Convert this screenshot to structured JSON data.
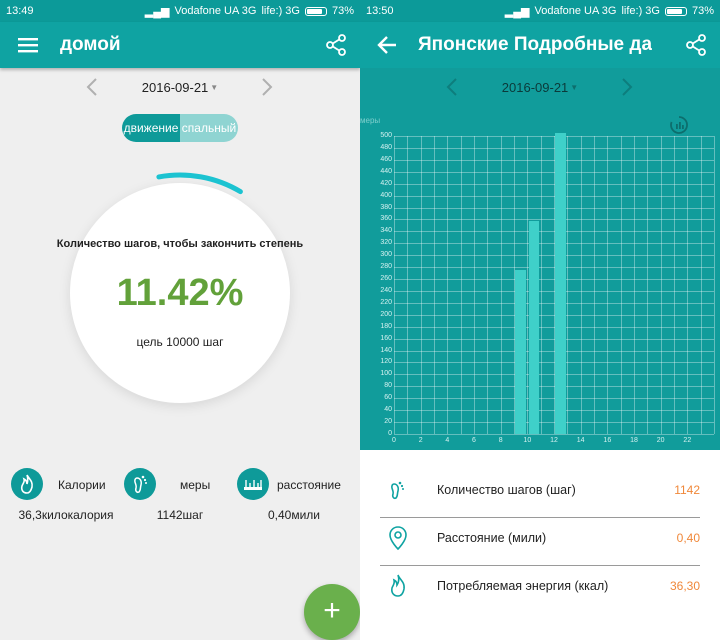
{
  "left": {
    "status": {
      "time": "13:49",
      "carrier": "Vodafone UA 3G",
      "carrier2": "life:) 3G",
      "battery": "73%"
    },
    "appbar": {
      "title": "домой"
    },
    "date": "2016-09-21",
    "toggle": {
      "active": "движение",
      "inactive": "спальный"
    },
    "progress": {
      "label": "Количество шагов, чтобы закончить степень",
      "percent_text": "11.42%",
      "fraction": 0.1142,
      "goal": "цель 10000 шаг"
    },
    "stats": [
      {
        "icon": "flame-icon",
        "label": "Калории",
        "value": "36,3килокалория"
      },
      {
        "icon": "footprint-icon",
        "label": "меры",
        "value": "1142шаг"
      },
      {
        "icon": "ruler-icon",
        "label": "расстояние",
        "value": "0,40мили"
      }
    ],
    "fab": {
      "label": "+"
    }
  },
  "right": {
    "status": {
      "time": "13:50",
      "carrier": "Vodafone UA 3G",
      "carrier2": "life:) 3G",
      "battery": "73%"
    },
    "appbar": {
      "title": "Японские Подробные да"
    },
    "date": "2016-09-21",
    "chart_data": {
      "type": "bar",
      "ylabel": "меры",
      "ylim": [
        0,
        500
      ],
      "yticks": [
        0,
        20,
        40,
        60,
        80,
        100,
        120,
        140,
        160,
        180,
        200,
        220,
        240,
        260,
        280,
        300,
        320,
        340,
        360,
        380,
        400,
        420,
        440,
        460,
        480,
        500
      ],
      "xlim": [
        0,
        24
      ],
      "xticks": [
        0,
        2,
        4,
        6,
        8,
        10,
        12,
        14,
        16,
        18,
        20,
        22
      ],
      "bars": [
        {
          "hour": 9,
          "value": 275
        },
        {
          "hour": 10,
          "value": 357
        },
        {
          "hour": 12,
          "value": 510
        }
      ],
      "grid": true
    },
    "details": [
      {
        "icon": "footprint-icon",
        "label": "Количество шагов (шаг)",
        "value": "1142"
      },
      {
        "icon": "location-pin-icon",
        "label": "Расстояние (мили)",
        "value": "0,40"
      },
      {
        "icon": "flame-icon",
        "label": "Потребляемая энергия (ккал)",
        "value": "36,30"
      }
    ]
  },
  "colors": {
    "primary": "#0fa3a2",
    "chart_bg": "#119c9b",
    "bar": "#3fd0c9",
    "accent_green": "#6ab04c",
    "value_orange": "#f0883a",
    "arc": "#1cc3d1"
  }
}
